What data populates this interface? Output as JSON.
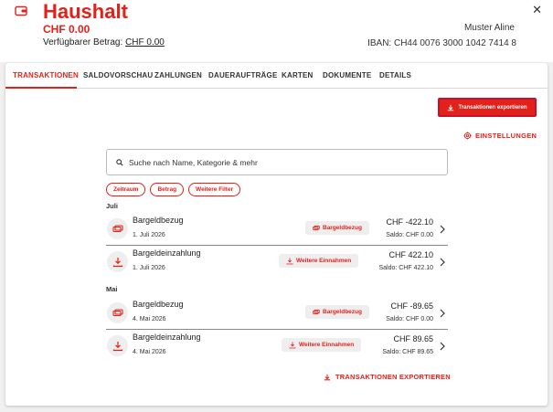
{
  "header": {
    "title": "Haushalt",
    "balance": "CHF 0.00",
    "available_label": "Verfügbarer Betrag:",
    "available_value": "CHF 0.00",
    "owner": "Muster Aline",
    "iban": "IBAN: CH44 0076 3000 1042 7414 8",
    "close": "✕"
  },
  "tabs": [
    {
      "label": "TRANSAKTIONEN",
      "active": true
    },
    {
      "label": "SALDOVORSCHAU"
    },
    {
      "label": "ZAHLUNGEN"
    },
    {
      "label": "DAUERAUFTRÄGE"
    },
    {
      "label": "KARTEN"
    },
    {
      "label": "DOKUMENTE"
    },
    {
      "label": "DETAILS"
    }
  ],
  "actions": {
    "export_top": "Transaktionen exportieren",
    "settings": "EINSTELLUNGEN",
    "export_bottom": "TRANSAKTIONEN EXPORTIEREN"
  },
  "search": {
    "placeholder": "Suche nach Name, Kategorie & mehr"
  },
  "filters": [
    "Zeitraum",
    "Betrag",
    "Weitere Filter"
  ],
  "months": [
    {
      "label": "Juli",
      "transactions": [
        {
          "name": "Bargeldbezug",
          "date": "1. Juli 2026",
          "category": "Bargeldbezug",
          "category_icon": "cash-icon",
          "amount": "CHF -422.10",
          "saldo": "Saldo: CHF 0.00",
          "icon": "cash-withdrawal-icon"
        },
        {
          "name": "Bargeldeinzahlung",
          "date": "1. Juli 2026",
          "category": "Weitere Einnahmen",
          "category_icon": "download-icon",
          "amount": "CHF 422.10",
          "saldo": "Saldo: CHF 422.10",
          "icon": "cash-deposit-icon"
        }
      ]
    },
    {
      "label": "Mai",
      "transactions": [
        {
          "name": "Bargeldbezug",
          "date": "4. Mai 2026",
          "category": "Bargeldbezug",
          "category_icon": "cash-icon",
          "amount": "CHF -89.65",
          "saldo": "Saldo: CHF 0.00",
          "icon": "cash-withdrawal-icon"
        },
        {
          "name": "Bargeldeinzahlung",
          "date": "4. Mai 2026",
          "category": "Weitere Einnahmen",
          "category_icon": "download-icon",
          "amount": "CHF 89.65",
          "saldo": "Saldo: CHF 89.65",
          "icon": "cash-deposit-icon"
        }
      ]
    }
  ],
  "colors": {
    "accent": "#e3211b",
    "background": "#f0f0f0",
    "badge_bg": "#eeeeee"
  }
}
